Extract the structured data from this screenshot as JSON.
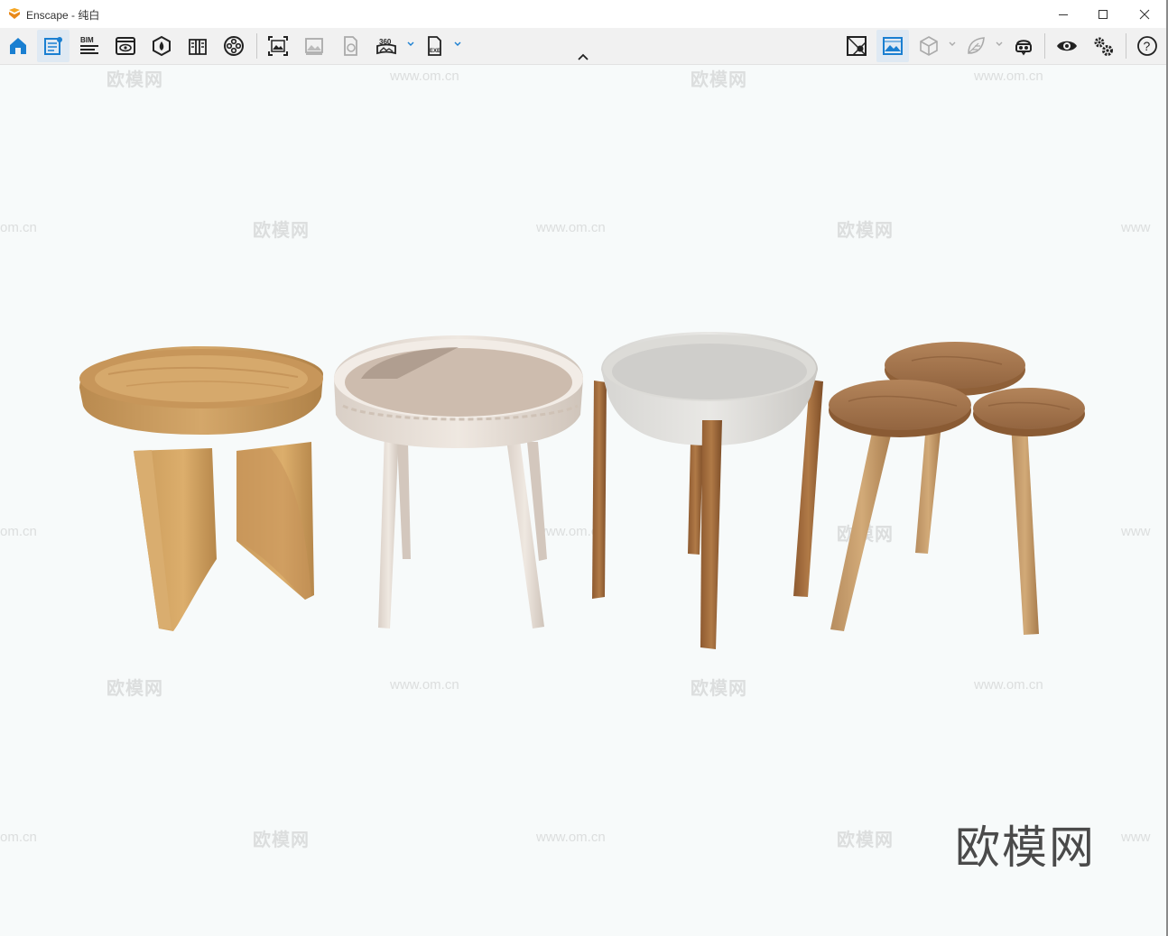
{
  "window": {
    "title": "Enscape - 纯白",
    "controls": [
      "minimize-icon",
      "maximize-icon",
      "close-icon"
    ]
  },
  "toolbar": {
    "left_tools": [
      "home-icon",
      "assets-icon",
      "bim-icon",
      "view-eye-icon",
      "atmosphere-icon",
      "material-library-icon",
      "video-editor-icon",
      "screenshot-icon",
      "batch-render-icon",
      "web-standalone-icon",
      "panorama-360-icon",
      "export-exe-icon"
    ],
    "bim_label": "BIM",
    "panorama_label": "360",
    "exe_label": "EXE",
    "right_tools": [
      "map-pin-icon",
      "image-view-icon",
      "cube-icon",
      "leaf-icon",
      "vr-headset-icon",
      "visibility-icon",
      "settings-gears-icon",
      "help-icon"
    ],
    "help_label": "?"
  },
  "watermark": {
    "logo_text": "欧模网",
    "url_text": "www.om.cn",
    "url_partial": "om.cn",
    "url_partial_right": "www"
  },
  "scene": {
    "objects": [
      "oak-stool",
      "carved-tray-table",
      "concrete-bowl-table",
      "clover-side-table"
    ]
  }
}
